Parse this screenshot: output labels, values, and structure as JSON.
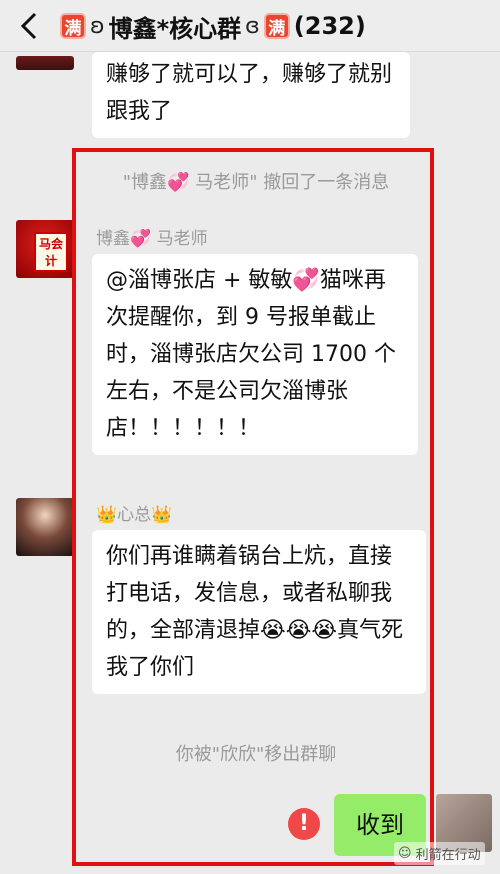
{
  "header": {
    "badge_left": "满",
    "title": "博鑫*核心群",
    "badge_right": "满",
    "member_count": "(232)"
  },
  "messages": {
    "top_bubble": "赚够了就可以了，赚够了就别跟我了",
    "recall_notice": "\"博鑫💞 马老师\" 撤回了一条消息",
    "ma_sender": "博鑫💞 马老师",
    "ma_bubble": "@淄博张店 + 敏敏💞猫咪再次提醒你，到 9 号报单截止时，淄博张店欠公司 1700 个左右，不是公司欠淄博张店！！！！！！",
    "ma_avatar_text": "马会计",
    "xin_sender": "👑心总👑",
    "xin_bubble": "你们再谁瞒着锅台上炕，直接打电话，发信息，或者私聊我的，全部清退掉😭😭😭真气死我了你们",
    "removed_notice": "你被\"欣欣\"移出群聊",
    "my_bubble": "收到",
    "error_mark": "!"
  },
  "watermark": "利箭在行动",
  "colors": {
    "frame_red": "#d11111",
    "my_bubble_green": "#95ec69",
    "error_red": "#f04848",
    "badge_red": "#e8462f"
  }
}
